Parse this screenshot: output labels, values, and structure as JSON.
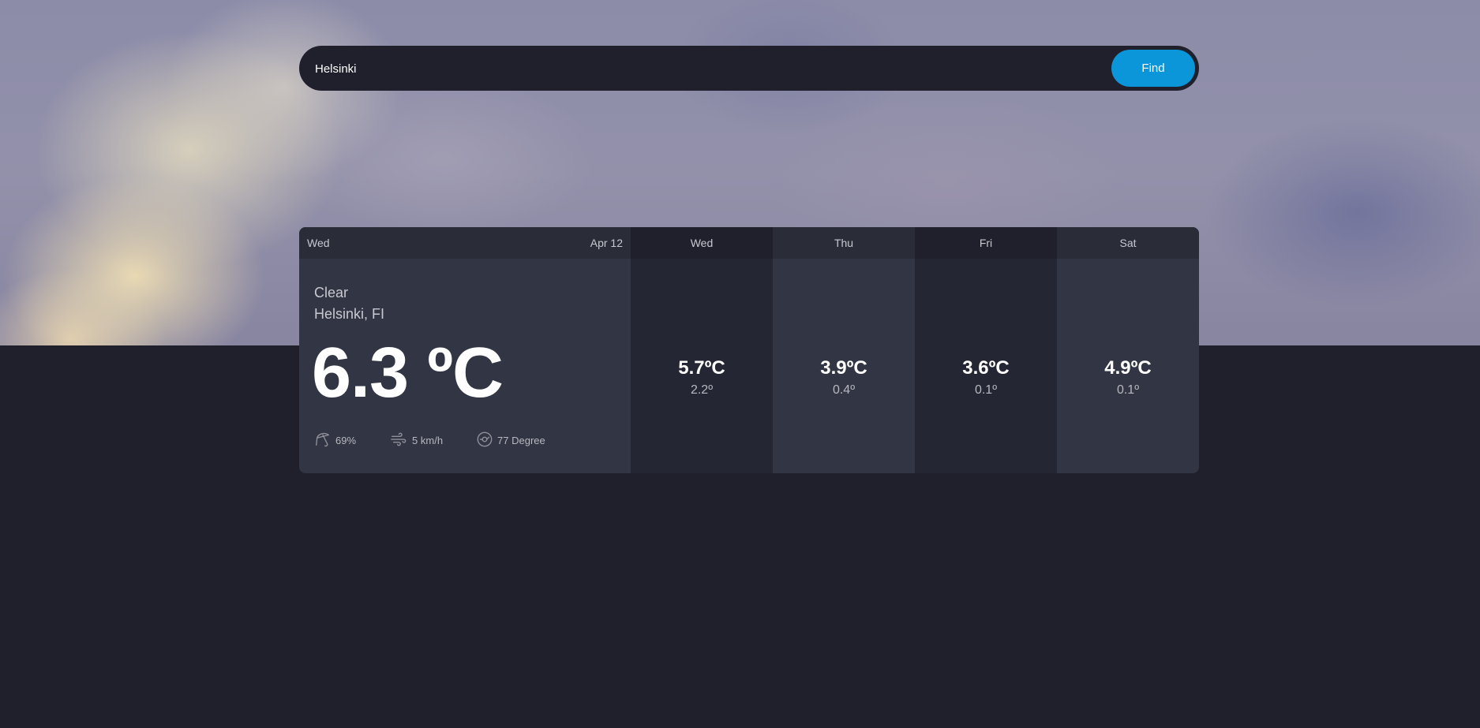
{
  "search": {
    "value": "Helsinki",
    "button_label": "Find"
  },
  "today": {
    "day": "Wed",
    "date": "Apr 12",
    "condition": "Clear",
    "location": "Helsinki, FI",
    "temperature": "6.3 ºC",
    "humidity": "69%",
    "wind": "5 km/h",
    "wind_direction": "77 Degree"
  },
  "forecast": [
    {
      "day": "Wed",
      "max": "5.7ºC",
      "min": "2.2º"
    },
    {
      "day": "Thu",
      "max": "3.9ºC",
      "min": "0.4º"
    },
    {
      "day": "Fri",
      "max": "3.6ºC",
      "min": "0.1º"
    },
    {
      "day": "Sat",
      "max": "4.9ºC",
      "min": "0.1º"
    }
  ],
  "icons": {
    "humidity": "umbrella-icon",
    "wind": "wind-icon",
    "direction": "compass-icon"
  },
  "colors": {
    "background": "#1f202c",
    "accent": "#0a96d8",
    "card": "#323543"
  }
}
